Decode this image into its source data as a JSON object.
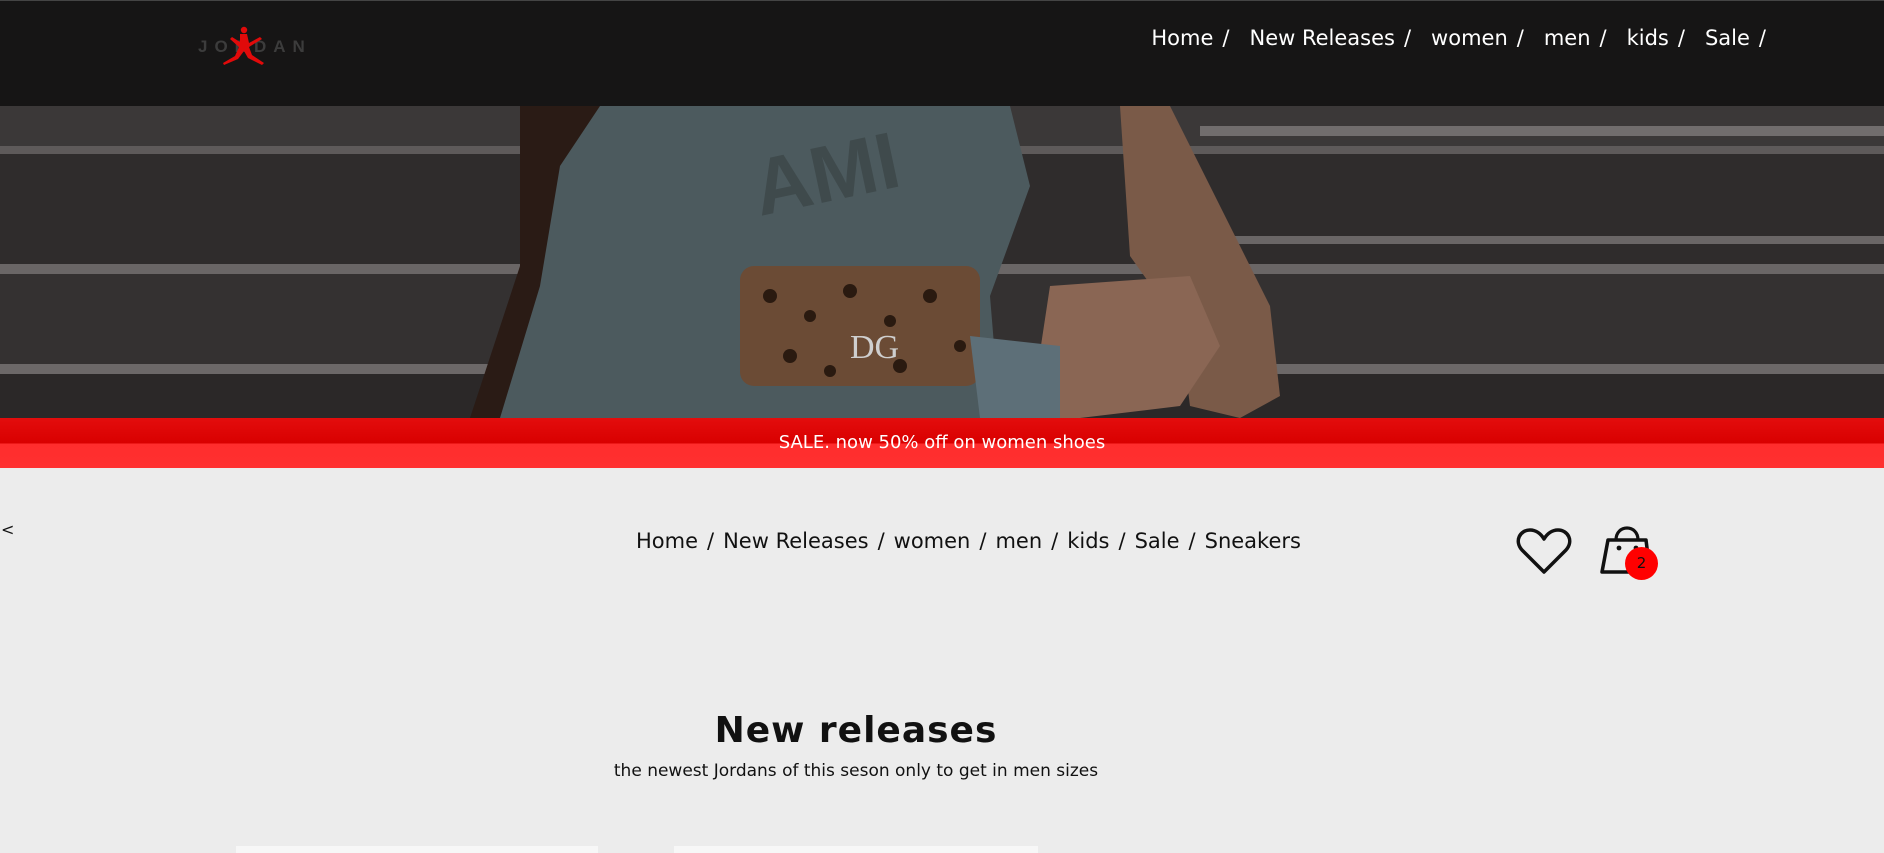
{
  "brand": {
    "logo_text": "JORDAN",
    "logo_color": "#e00000"
  },
  "topnav": {
    "items": [
      "Home",
      "New Releases",
      "women",
      "men",
      "kids",
      "Sale"
    ],
    "separator": "/"
  },
  "hero": {
    "image": "woman-sitting-on-stairs-photo"
  },
  "sale_banner": {
    "text": "SALE. now 50% off on women shoes",
    "color": "#e00000"
  },
  "subnav": {
    "back": "<",
    "items": [
      "Home",
      "New Releases",
      "women",
      "men",
      "kids",
      "Sale",
      "Sneakers"
    ],
    "separator": "/"
  },
  "actions": {
    "wishlist_icon": "heart-icon",
    "cart_icon": "shopping-bag-icon",
    "cart_count": "2",
    "badge_color": "#ff0000"
  },
  "section": {
    "title": "New releases",
    "subtitle": "the newest Jordans of this seson only to get in men sizes"
  }
}
